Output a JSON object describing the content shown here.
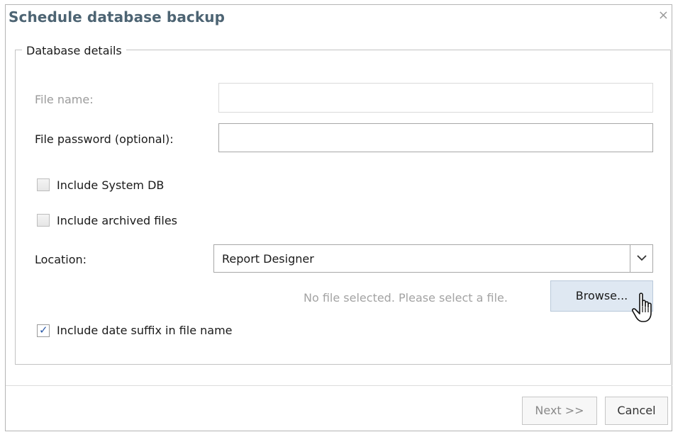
{
  "dialog": {
    "title": "Schedule database backup",
    "close_glyph": "×"
  },
  "fieldset": {
    "legend": "Database details"
  },
  "fields": {
    "file_name_label": "File name:",
    "file_name_value": "",
    "file_password_label": "File password (optional):",
    "file_password_value": "",
    "location_label": "Location:",
    "location_value": "Report Designer"
  },
  "checkboxes": {
    "include_system_db": {
      "label": "Include System DB",
      "checked": false
    },
    "include_archived": {
      "label": "Include archived files",
      "checked": false
    },
    "include_date_suffix": {
      "label": "Include date suffix in file name",
      "checked": true
    }
  },
  "file_picker": {
    "status_text": "No file selected. Please select a file.",
    "browse_label": "Browse..."
  },
  "footer": {
    "next_label": "Next >>",
    "cancel_label": "Cancel"
  },
  "icons": {
    "close": "close-icon",
    "dropdown": "chevron-down-icon",
    "checkmark": "checkmark-icon",
    "cursor": "hand-pointer-icon"
  },
  "colors": {
    "title": "#4d6473",
    "browse_bg": "#dfe8f2",
    "check": "#2b5aa8",
    "muted_text": "#a3a3a3"
  }
}
